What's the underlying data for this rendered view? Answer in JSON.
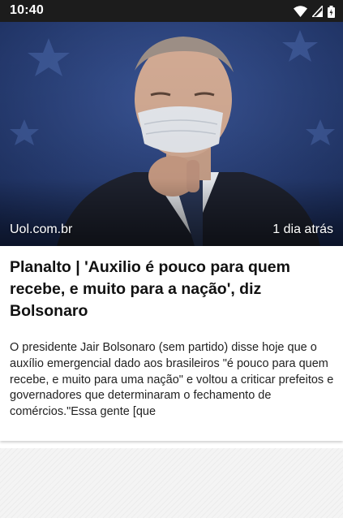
{
  "status_bar": {
    "time": "10:40",
    "icons": [
      "wifi-icon",
      "signal-icon",
      "battery-icon"
    ]
  },
  "article": {
    "source": "Uol.com.br",
    "time_ago": "1 dia atrás",
    "headline": "Planalto | 'Auxilio é pouco para quem recebe, e muito para a nação', diz Bolsonaro",
    "summary": "O presidente Jair Bolsonaro (sem partido) disse hoje que o auxílio emergencial dado aos brasileiros \"é pouco para quem recebe, e muito para uma nação\" e voltou a criticar prefeitos e governadores que determinaram o fechamento de comércios.\"Essa gente [que"
  },
  "colors": {
    "status_bar": "#1c1c1c",
    "hero_background": "#233a6f",
    "headline_text": "#111111",
    "summary_text": "#222222"
  }
}
